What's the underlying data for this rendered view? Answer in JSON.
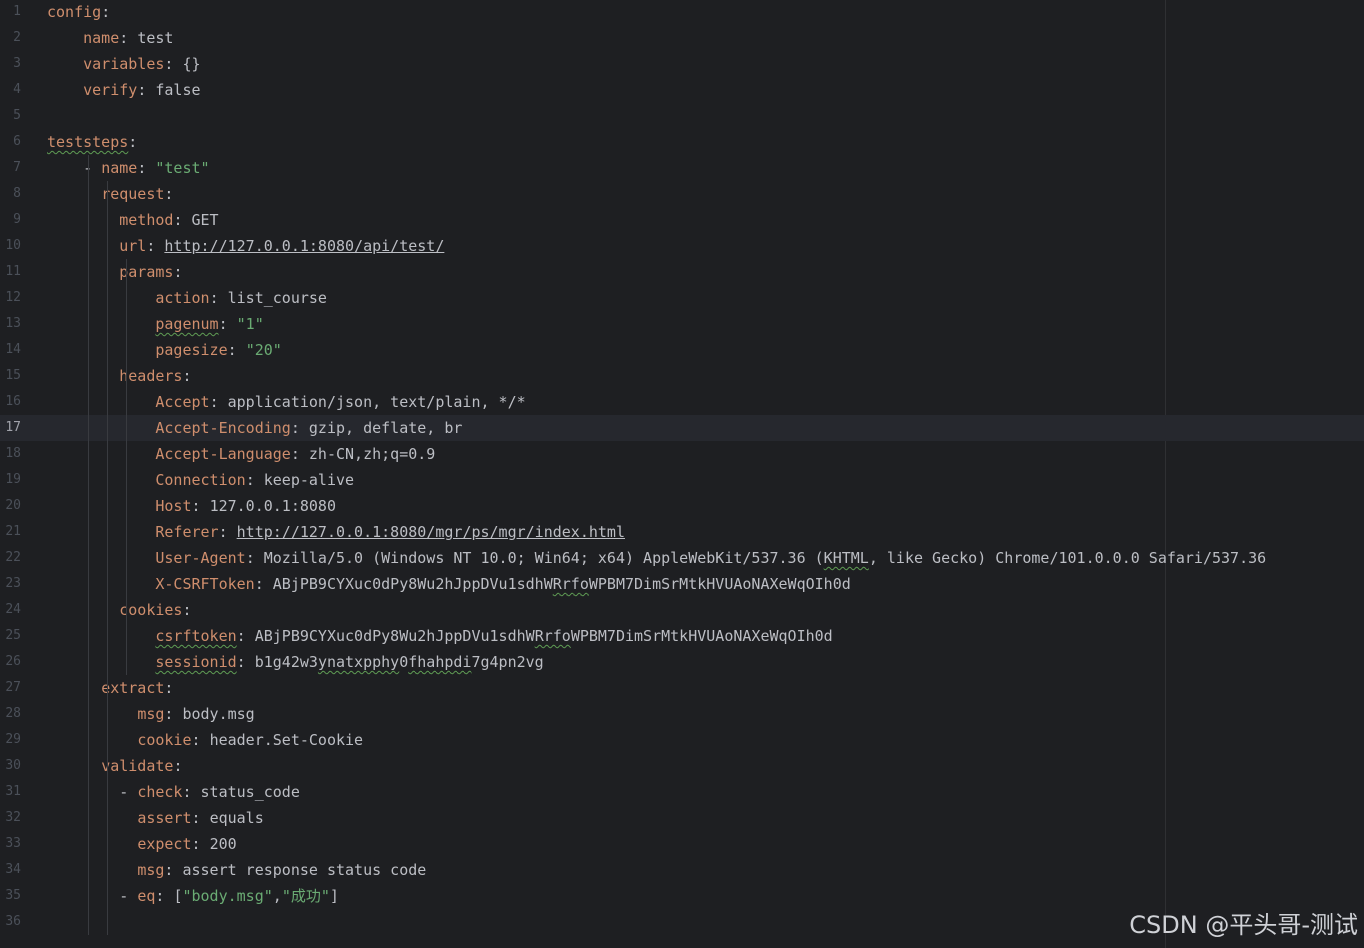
{
  "editor": {
    "current_line": 17,
    "colors": {
      "background": "#1e1f22",
      "key": "#cf8e6d",
      "string": "#6aab73",
      "text": "#bcbec4",
      "line_number": "#4b5059",
      "current_line_bg": "#26282e"
    },
    "lines": [
      {
        "n": "1",
        "parts": [
          {
            "t": "config",
            "c": "k"
          },
          {
            "t": ":",
            "c": "p"
          }
        ]
      },
      {
        "n": "2",
        "parts": [
          {
            "t": "    "
          },
          {
            "t": "name",
            "c": "k"
          },
          {
            "t": ": ",
            "c": "p"
          },
          {
            "t": "test",
            "c": "v"
          }
        ]
      },
      {
        "n": "3",
        "parts": [
          {
            "t": "    "
          },
          {
            "t": "variables",
            "c": "k"
          },
          {
            "t": ": ",
            "c": "p"
          },
          {
            "t": "{}",
            "c": "v"
          }
        ]
      },
      {
        "n": "4",
        "parts": [
          {
            "t": "    "
          },
          {
            "t": "verify",
            "c": "k"
          },
          {
            "t": ": ",
            "c": "p"
          },
          {
            "t": "false",
            "c": "v"
          }
        ]
      },
      {
        "n": "5",
        "parts": []
      },
      {
        "n": "6",
        "parts": [
          {
            "t": "teststeps",
            "c": "k w"
          },
          {
            "t": ":",
            "c": "p"
          }
        ]
      },
      {
        "n": "7",
        "parts": [
          {
            "t": "    - "
          },
          {
            "t": "name",
            "c": "k"
          },
          {
            "t": ": ",
            "c": "p"
          },
          {
            "t": "\"test\"",
            "c": "s"
          }
        ]
      },
      {
        "n": "8",
        "parts": [
          {
            "t": "      "
          },
          {
            "t": "request",
            "c": "k"
          },
          {
            "t": ":",
            "c": "p"
          }
        ]
      },
      {
        "n": "9",
        "parts": [
          {
            "t": "        "
          },
          {
            "t": "method",
            "c": "k"
          },
          {
            "t": ": ",
            "c": "p"
          },
          {
            "t": "GET",
            "c": "v"
          }
        ]
      },
      {
        "n": "10",
        "parts": [
          {
            "t": "        "
          },
          {
            "t": "url",
            "c": "k"
          },
          {
            "t": ": ",
            "c": "p"
          },
          {
            "t": "http://127.0.0.1:8080/api/test/",
            "c": "u",
            "link": true
          }
        ]
      },
      {
        "n": "11",
        "parts": [
          {
            "t": "        "
          },
          {
            "t": "params",
            "c": "k"
          },
          {
            "t": ":",
            "c": "p"
          }
        ]
      },
      {
        "n": "12",
        "parts": [
          {
            "t": "            "
          },
          {
            "t": "action",
            "c": "k"
          },
          {
            "t": ": ",
            "c": "p"
          },
          {
            "t": "list_course",
            "c": "v"
          }
        ]
      },
      {
        "n": "13",
        "parts": [
          {
            "t": "            "
          },
          {
            "t": "pagenum",
            "c": "k w"
          },
          {
            "t": ": ",
            "c": "p"
          },
          {
            "t": "\"1\"",
            "c": "s"
          }
        ]
      },
      {
        "n": "14",
        "parts": [
          {
            "t": "            "
          },
          {
            "t": "pagesize",
            "c": "k"
          },
          {
            "t": ": ",
            "c": "p"
          },
          {
            "t": "\"20\"",
            "c": "s"
          }
        ]
      },
      {
        "n": "15",
        "parts": [
          {
            "t": "        "
          },
          {
            "t": "headers",
            "c": "k"
          },
          {
            "t": ":",
            "c": "p"
          }
        ]
      },
      {
        "n": "16",
        "parts": [
          {
            "t": "            "
          },
          {
            "t": "Accept",
            "c": "k"
          },
          {
            "t": ": ",
            "c": "p"
          },
          {
            "t": "application/json, text/plain, */*",
            "c": "v"
          }
        ]
      },
      {
        "n": "17",
        "parts": [
          {
            "t": "            "
          },
          {
            "t": "Accept-Encoding",
            "c": "k"
          },
          {
            "t": ": ",
            "c": "p"
          },
          {
            "t": "gzip, deflate, br",
            "c": "v"
          }
        ]
      },
      {
        "n": "18",
        "parts": [
          {
            "t": "            "
          },
          {
            "t": "Accept-Language",
            "c": "k"
          },
          {
            "t": ": ",
            "c": "p"
          },
          {
            "t": "zh-CN,zh;q=0.9",
            "c": "v"
          }
        ]
      },
      {
        "n": "19",
        "parts": [
          {
            "t": "            "
          },
          {
            "t": "Connection",
            "c": "k"
          },
          {
            "t": ": ",
            "c": "p"
          },
          {
            "t": "keep-alive",
            "c": "v"
          }
        ]
      },
      {
        "n": "20",
        "parts": [
          {
            "t": "            "
          },
          {
            "t": "Host",
            "c": "k"
          },
          {
            "t": ": ",
            "c": "p"
          },
          {
            "t": "127.0.0.1:8080",
            "c": "v"
          }
        ]
      },
      {
        "n": "21",
        "parts": [
          {
            "t": "            "
          },
          {
            "t": "Referer",
            "c": "k"
          },
          {
            "t": ": ",
            "c": "p"
          },
          {
            "t": "http://127.0.0.1:8080/mgr/ps/mgr/index.html",
            "c": "u",
            "link": true
          }
        ]
      },
      {
        "n": "22",
        "parts": [
          {
            "t": "            "
          },
          {
            "t": "User-Agent",
            "c": "k"
          },
          {
            "t": ": ",
            "c": "p"
          },
          {
            "t": "Mozilla/5.0 (Windows NT 10.0; Win64; x64) AppleWebKit/537.36 (",
            "c": "v"
          },
          {
            "t": "KHTML",
            "c": "v w"
          },
          {
            "t": ", like Gecko) Chrome/101.0.0.0 Safari/537.36",
            "c": "v"
          }
        ]
      },
      {
        "n": "23",
        "parts": [
          {
            "t": "            "
          },
          {
            "t": "X-CSRFToken",
            "c": "k"
          },
          {
            "t": ": ",
            "c": "p"
          },
          {
            "t": "ABjPB9CYXuc0dPy8Wu2hJppDVu1sdhW",
            "c": "v"
          },
          {
            "t": "Rrfo",
            "c": "v w"
          },
          {
            "t": "WPBM7DimSrMtkHVUAoNAXeWqOIh0d",
            "c": "v"
          }
        ]
      },
      {
        "n": "24",
        "parts": [
          {
            "t": "        "
          },
          {
            "t": "cookies",
            "c": "k"
          },
          {
            "t": ":",
            "c": "p"
          }
        ]
      },
      {
        "n": "25",
        "parts": [
          {
            "t": "            "
          },
          {
            "t": "csrftoken",
            "c": "k w"
          },
          {
            "t": ": ",
            "c": "p"
          },
          {
            "t": "ABjPB9CYXuc0dPy8Wu2hJppDVu1sdhW",
            "c": "v"
          },
          {
            "t": "Rrfo",
            "c": "v w"
          },
          {
            "t": "WPBM7DimSrMtkHVUAoNAXeWqOIh0d",
            "c": "v"
          }
        ]
      },
      {
        "n": "26",
        "parts": [
          {
            "t": "            "
          },
          {
            "t": "sessionid",
            "c": "k w"
          },
          {
            "t": ": ",
            "c": "p"
          },
          {
            "t": "b1g42w3",
            "c": "v"
          },
          {
            "t": "ynatxpphy",
            "c": "v w"
          },
          {
            "t": "0",
            "c": "v"
          },
          {
            "t": "fhahpdi",
            "c": "v w"
          },
          {
            "t": "7g4pn2vg",
            "c": "v"
          }
        ]
      },
      {
        "n": "27",
        "parts": [
          {
            "t": "      "
          },
          {
            "t": "extract",
            "c": "k"
          },
          {
            "t": ":",
            "c": "p"
          }
        ]
      },
      {
        "n": "28",
        "parts": [
          {
            "t": "          "
          },
          {
            "t": "msg",
            "c": "k"
          },
          {
            "t": ": ",
            "c": "p"
          },
          {
            "t": "body.msg",
            "c": "v"
          }
        ]
      },
      {
        "n": "29",
        "parts": [
          {
            "t": "          "
          },
          {
            "t": "cookie",
            "c": "k"
          },
          {
            "t": ": ",
            "c": "p"
          },
          {
            "t": "header.Set-Cookie",
            "c": "v"
          }
        ]
      },
      {
        "n": "30",
        "parts": [
          {
            "t": "      "
          },
          {
            "t": "validate",
            "c": "k"
          },
          {
            "t": ":",
            "c": "p"
          }
        ]
      },
      {
        "n": "31",
        "parts": [
          {
            "t": "        - "
          },
          {
            "t": "check",
            "c": "k"
          },
          {
            "t": ": ",
            "c": "p"
          },
          {
            "t": "status_code",
            "c": "v"
          }
        ]
      },
      {
        "n": "32",
        "parts": [
          {
            "t": "          "
          },
          {
            "t": "assert",
            "c": "k"
          },
          {
            "t": ": ",
            "c": "p"
          },
          {
            "t": "equals",
            "c": "v"
          }
        ]
      },
      {
        "n": "33",
        "parts": [
          {
            "t": "          "
          },
          {
            "t": "expect",
            "c": "k"
          },
          {
            "t": ": ",
            "c": "p"
          },
          {
            "t": "200",
            "c": "v"
          }
        ]
      },
      {
        "n": "34",
        "parts": [
          {
            "t": "          "
          },
          {
            "t": "msg",
            "c": "k"
          },
          {
            "t": ": ",
            "c": "p"
          },
          {
            "t": "assert response status code",
            "c": "v"
          }
        ]
      },
      {
        "n": "35",
        "parts": [
          {
            "t": "        - "
          },
          {
            "t": "eq",
            "c": "k"
          },
          {
            "t": ": ",
            "c": "p"
          },
          {
            "t": "[",
            "c": "v"
          },
          {
            "t": "\"body.msg\"",
            "c": "s"
          },
          {
            "t": ",",
            "c": "v"
          },
          {
            "t": "\"成功\"",
            "c": "s"
          },
          {
            "t": "]",
            "c": "v"
          }
        ]
      },
      {
        "n": "36",
        "parts": []
      }
    ]
  },
  "watermark": {
    "text": "CSDN @平头哥-测试"
  }
}
